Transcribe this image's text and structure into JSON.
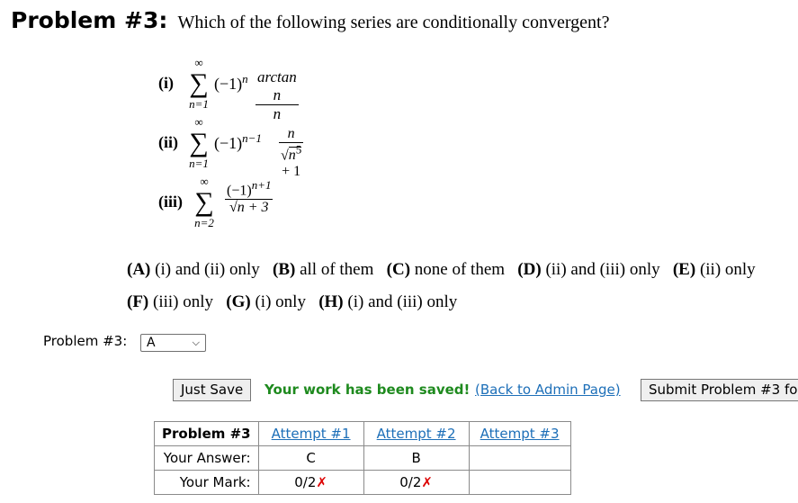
{
  "problem": {
    "label": "Problem #3:",
    "question": "Which of the following series are conditionally convergent?",
    "items": [
      {
        "numeral": "(i)",
        "sum_top": "∞",
        "sum_bottom": "n=1",
        "factor": "(−1)",
        "exp": "n",
        "num": "arctan n",
        "den": "n"
      },
      {
        "numeral": "(ii)",
        "sum_top": "∞",
        "sum_bottom": "n=1",
        "factor": "(−1)",
        "exp": "n−1",
        "num": "n",
        "den_rad": "n",
        "den_pow": "5",
        "den_rest": "+ 1"
      },
      {
        "numeral": "(iii)",
        "sum_top": "∞",
        "sum_bottom": "n=2",
        "num": "(−1)",
        "num_exp": "n+1",
        "den_rad": "n + 3"
      }
    ],
    "choices_line1": [
      {
        "key": "(A)",
        "text": "(i) and (ii) only"
      },
      {
        "key": "(B)",
        "text": "all of them"
      },
      {
        "key": "(C)",
        "text": "none of them"
      },
      {
        "key": "(D)",
        "text": "(ii) and (iii) only"
      },
      {
        "key": "(E)",
        "text": "(ii) only"
      }
    ],
    "choices_line2": [
      {
        "key": "(F)",
        "text": "(iii) only"
      },
      {
        "key": "(G)",
        "text": "(i) only"
      },
      {
        "key": "(H)",
        "text": "(i) and (iii) only"
      }
    ]
  },
  "answer": {
    "label": "Problem #3:",
    "selected": "A"
  },
  "actions": {
    "just_save": "Just Save",
    "saved_msg": "Your work has been saved!",
    "back_link": "(Back to Admin Page)",
    "submit": "Submit Problem #3 fo"
  },
  "attempts": {
    "header": "Problem #3",
    "columns": [
      "Attempt #1",
      "Attempt #2",
      "Attempt #3"
    ],
    "row_answer_label": "Your Answer:",
    "answers": [
      "C",
      "B",
      ""
    ],
    "row_mark_label": "Your Mark:",
    "marks": [
      "0/2",
      "0/2",
      ""
    ],
    "mark_symbol": "✗"
  }
}
